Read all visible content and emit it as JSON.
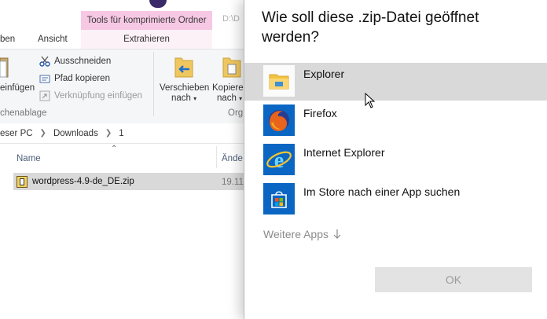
{
  "explorer": {
    "tool_header": "Tools für komprimierte Ordner",
    "path_snippet": "D:\\D",
    "tabs": [
      "ben",
      "Ansicht",
      "Extrahieren"
    ],
    "ribbon": {
      "cut": "Ausschneiden",
      "copy_path": "Pfad kopieren",
      "paste_shortcut": "Verknüpfung einfügen",
      "paste_partial": "einfügen",
      "clipboard_group": "chenablage",
      "move_to_line1": "Verschieben",
      "move_to_line2": "nach",
      "copy_to_line1": "Kopiere",
      "copy_to_line2": "nach",
      "organize_group": "Org"
    },
    "address": [
      "eser PC",
      "Downloads",
      "1"
    ],
    "columns": {
      "name": "Name",
      "date": "Ände"
    },
    "file": {
      "name": "wordpress-4.9-de_DE.zip",
      "date": "19.11"
    }
  },
  "dialog": {
    "title": "Wie soll diese .zip-Datei geöffnet werden?",
    "apps": [
      {
        "name": "Explorer",
        "icon": "file-explorer-icon",
        "selected": true
      },
      {
        "name": "Firefox",
        "icon": "firefox-icon",
        "selected": false
      },
      {
        "name": "Internet Explorer",
        "icon": "internet-explorer-icon",
        "selected": false
      },
      {
        "name": "Im Store nach einer App suchen",
        "icon": "store-icon",
        "selected": false
      }
    ],
    "more_apps": "Weitere Apps",
    "more_apps_icon": "arrow-down-icon",
    "ok_label": "OK"
  },
  "colors": {
    "tool_header_bg": "#f7c8e4",
    "selected_row": "#d9d9d9",
    "app_tile_blue": "#0078d7",
    "ok_button_bg": "#e3e3e3"
  }
}
